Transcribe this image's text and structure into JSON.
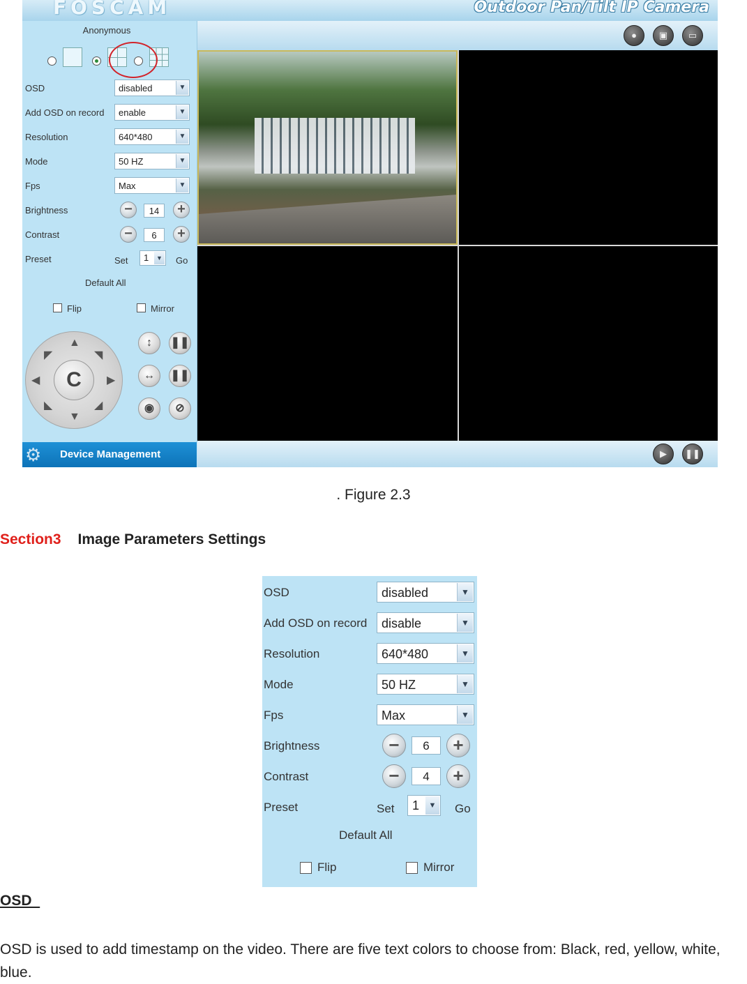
{
  "screenshot": {
    "logo": "FOSCAM",
    "product_title": "Outdoor Pan/Tilt IP Camera",
    "user": "Anonymous",
    "settings": {
      "osd_label": "OSD",
      "osd_value": "disabled",
      "osd_record_label": "Add OSD on record",
      "osd_record_value": "enable",
      "resolution_label": "Resolution",
      "resolution_value": "640*480",
      "mode_label": "Mode",
      "mode_value": "50 HZ",
      "fps_label": "Fps",
      "fps_value": "Max",
      "brightness_label": "Brightness",
      "brightness_value": "14",
      "contrast_label": "Contrast",
      "contrast_value": "6",
      "preset_label": "Preset",
      "preset_set": "Set",
      "preset_value": "1",
      "preset_go": "Go",
      "default_all": "Default All",
      "flip": "Flip",
      "mirror": "Mirror"
    },
    "ptz_center": "C",
    "device_management": "Device Management"
  },
  "caption": ". Figure 2.3",
  "section": {
    "number": "Section3",
    "title": "Image Parameters Settings"
  },
  "panel": {
    "osd_label": "OSD",
    "osd_value": "disabled",
    "osd_record_label": "Add OSD on record",
    "osd_record_value": "disable",
    "resolution_label": "Resolution",
    "resolution_value": "640*480",
    "mode_label": "Mode",
    "mode_value": "50 HZ",
    "fps_label": "Fps",
    "fps_value": "Max",
    "brightness_label": "Brightness",
    "brightness_value": "6",
    "contrast_label": "Contrast",
    "contrast_value": "4",
    "preset_label": "Preset",
    "preset_set": "Set",
    "preset_value": "1",
    "preset_go": "Go",
    "default_all": "Default All",
    "flip": "Flip",
    "mirror": "Mirror"
  },
  "osd": {
    "heading": "OSD  ",
    "body": "OSD is used to add timestamp on the video. There are five text colors to choose from: Black, red, yellow, white, blue."
  },
  "colors": {
    "section_number": "#e0201b",
    "panel_bg": "#bde3f5",
    "management_bar": "#1e90d6"
  },
  "icons": [
    "minus-icon",
    "plus-icon",
    "chevron-down-icon",
    "ptz-arrow-icon",
    "gear-icon",
    "play-icon",
    "pause-icon",
    "record-icon",
    "snapshot-icon"
  ]
}
